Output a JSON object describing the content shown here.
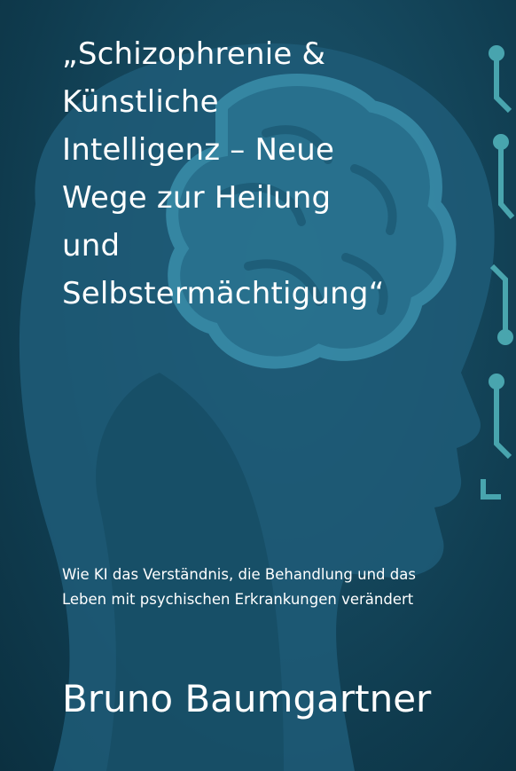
{
  "cover": {
    "title_lines": [
      "„Schizophrenie &",
      "Künstliche",
      "Intelligenz – Neue",
      "Wege zur Heilung",
      "und",
      "Selbstermächtigung“"
    ],
    "subtitle_lines": [
      "Wie KI das Verständnis, die Behandlung und das",
      "Leben mit psychischen Erkrankungen verändert"
    ],
    "author": "Bruno Baumgartner",
    "colors": {
      "background": "#0f3a4c",
      "head_silhouette": "#1e5c78",
      "brain": "#2f7f9c",
      "circuit_accent": "#4fb0b8",
      "text": "#ffffff"
    },
    "icons": [
      "head-silhouette-icon",
      "brain-icon",
      "circuit-icon"
    ]
  }
}
